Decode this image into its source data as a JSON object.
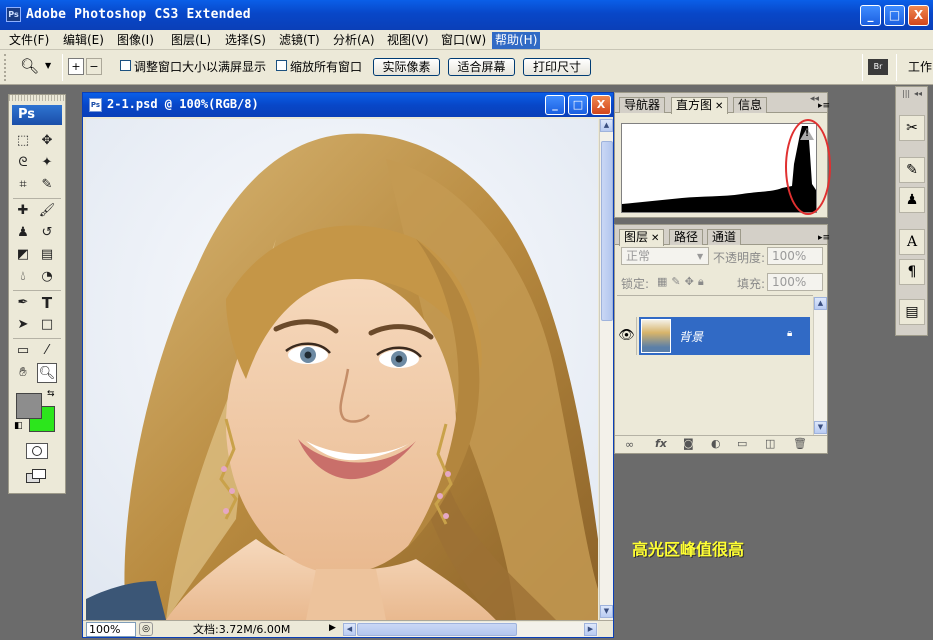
{
  "app": {
    "icon_text": "Ps",
    "title": "Adobe Photoshop CS3 Extended",
    "window_controls": {
      "minimize": "_",
      "maximize": "□",
      "close": "X"
    }
  },
  "menubar": {
    "items": [
      "文件(F)",
      "编辑(E)",
      "图像(I)",
      "图层(L)",
      "选择(S)",
      "滤镜(T)",
      "分析(A)",
      "视图(V)",
      "窗口(W)",
      "帮助(H)"
    ],
    "active": "帮助(H)"
  },
  "options": {
    "resize_windows_label": "调整窗口大小以满屏显示",
    "zoom_all_label": "缩放所有窗口",
    "actual_pixels": "实际像素",
    "fit_screen": "适合屏幕",
    "print_size": "打印尺寸",
    "workspace_label": "工作"
  },
  "toolbox": {
    "logo": "Ps"
  },
  "document": {
    "title": "2-1.psd @ 100%(RGB/8)",
    "zoom": "100%",
    "doc_size": "文档:3.72M/6.00M"
  },
  "panels": {
    "histogram": {
      "tabs": [
        "导航器",
        "直方图",
        "信息"
      ],
      "active_tab": "直方图",
      "clipping_warning": "!"
    },
    "layers": {
      "tabs": [
        "图层",
        "路径",
        "通道"
      ],
      "active_tab": "图层",
      "blend_mode": "正常",
      "opacity_label": "不透明度:",
      "opacity_value": "100%",
      "lock_label": "锁定:",
      "fill_label": "填充:",
      "fill_value": "100%",
      "layer_name": "背景"
    }
  },
  "annotation": "高光区峰值很高",
  "colors": {
    "foreground": "#8d8d8d",
    "background": "#2ce61c",
    "accent": "#316ac5"
  }
}
